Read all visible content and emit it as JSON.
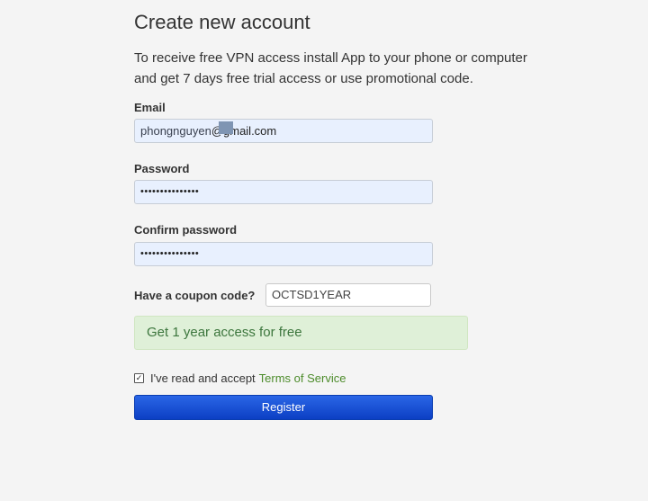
{
  "form": {
    "title": "Create new account",
    "intro": "To receive free VPN access install App to your phone or computer and get 7 days free trial access or use promotional code.",
    "email": {
      "label": "Email",
      "value_visible_prefix": "phongnguyen",
      "value_visible_suffix": "@gmail.com"
    },
    "password": {
      "label": "Password",
      "value": "•••••••••••••••"
    },
    "confirm_password": {
      "label": "Confirm password",
      "value": "•••••••••••••••"
    },
    "coupon": {
      "label": "Have a coupon code?",
      "value": "OCTSD1YEAR"
    },
    "promo_message": "Get 1 year access for free",
    "terms": {
      "checked": true,
      "check_glyph": "✓",
      "text": "I've read and accept",
      "link_text": "Terms of Service"
    },
    "register_label": "Register"
  },
  "colors": {
    "background": "#f4f4f4",
    "autofill_field": "#e8f0fe",
    "success_bg": "#dff0d8",
    "success_text": "#3c763d",
    "link": "#4c8b2a",
    "button": "#1e54d8"
  }
}
